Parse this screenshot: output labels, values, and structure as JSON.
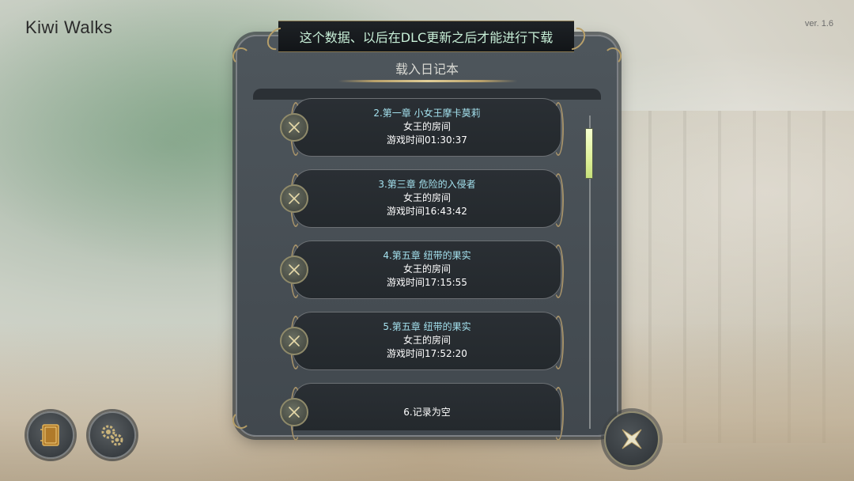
{
  "app": {
    "brand": "Kiwi Walks",
    "version": "ver. 1.6"
  },
  "banner": {
    "text": "这个数据、以后在DLC更新之后才能进行下载"
  },
  "panel": {
    "title": "载入日记本",
    "slots": [
      {
        "chapter": "2.第一章 小女王摩卡莫莉",
        "location": "女王的房间",
        "playtime": "游戏时间01:30:37"
      },
      {
        "chapter": "3.第三章 危险的入侵者",
        "location": "女王的房间",
        "playtime": "游戏时间16:43:42"
      },
      {
        "chapter": "4.第五章 纽带的果实",
        "location": "女王的房间",
        "playtime": "游戏时间17:15:55"
      },
      {
        "chapter": "5.第五章 纽带的果实",
        "location": "女王的房间",
        "playtime": "游戏时间17:52:20"
      },
      {
        "empty_label": "6.记录为空"
      }
    ]
  },
  "colors": {
    "accent_gold": "#b8a06a",
    "chapter_text": "#a4e1ee",
    "banner_text": "#c8f0d8",
    "scroll_thumb": "#dff19a"
  },
  "icons": {
    "delete": "x-icon",
    "diary": "book-icon",
    "settings": "gears-icon",
    "close": "star-close-icon"
  }
}
